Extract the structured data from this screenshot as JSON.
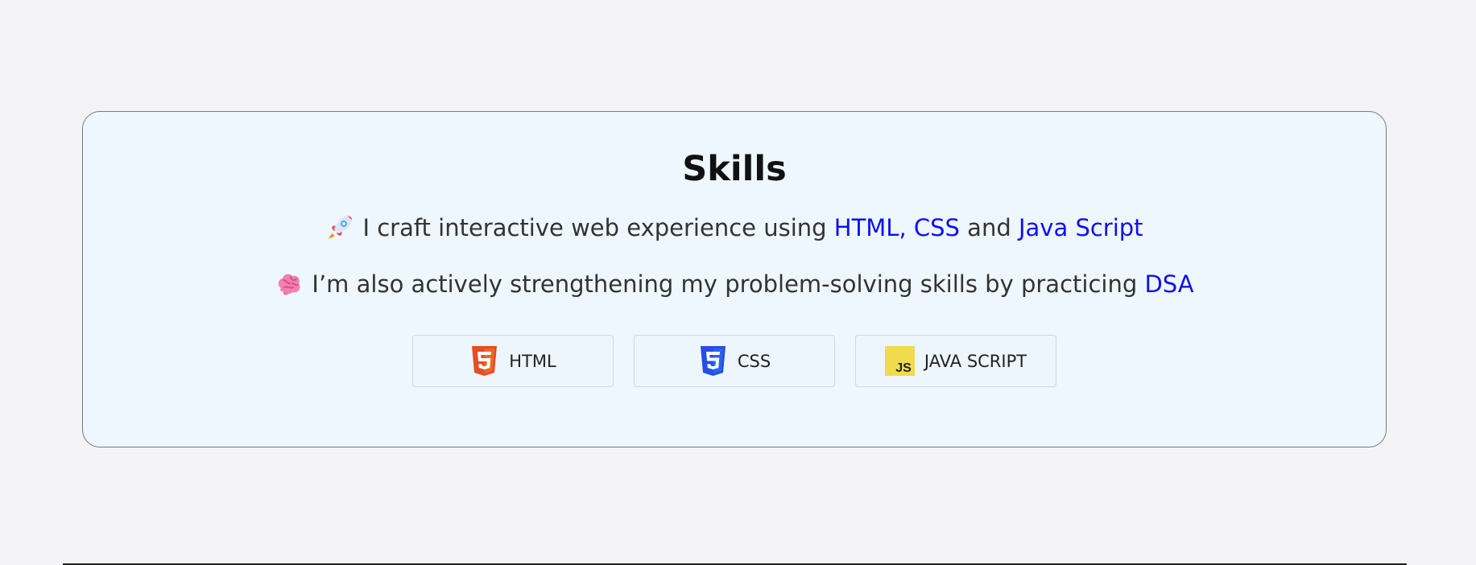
{
  "skills": {
    "title": "Skills",
    "line_one": {
      "icon": "rocket-icon",
      "text_before": "I craft interactive web experience using ",
      "highlight_one": "HTML, CSS",
      "text_middle": " and ",
      "highlight_two": "Java Script"
    },
    "line_two": {
      "icon": "brain-icon",
      "text_before": "I’m also actively strengthening my problem-solving skills by practicing ",
      "highlight": "DSA"
    },
    "badges": [
      {
        "label": "HTML",
        "icon": "html5-icon"
      },
      {
        "label": "CSS",
        "icon": "css3-icon"
      },
      {
        "label": "JAVA SCRIPT",
        "icon": "javascript-icon"
      }
    ],
    "colors": {
      "highlight": "#1010f0",
      "card_background": "#eef7fe",
      "card_border": "#7a7a7a",
      "page_background": "#f4f4f6"
    }
  }
}
